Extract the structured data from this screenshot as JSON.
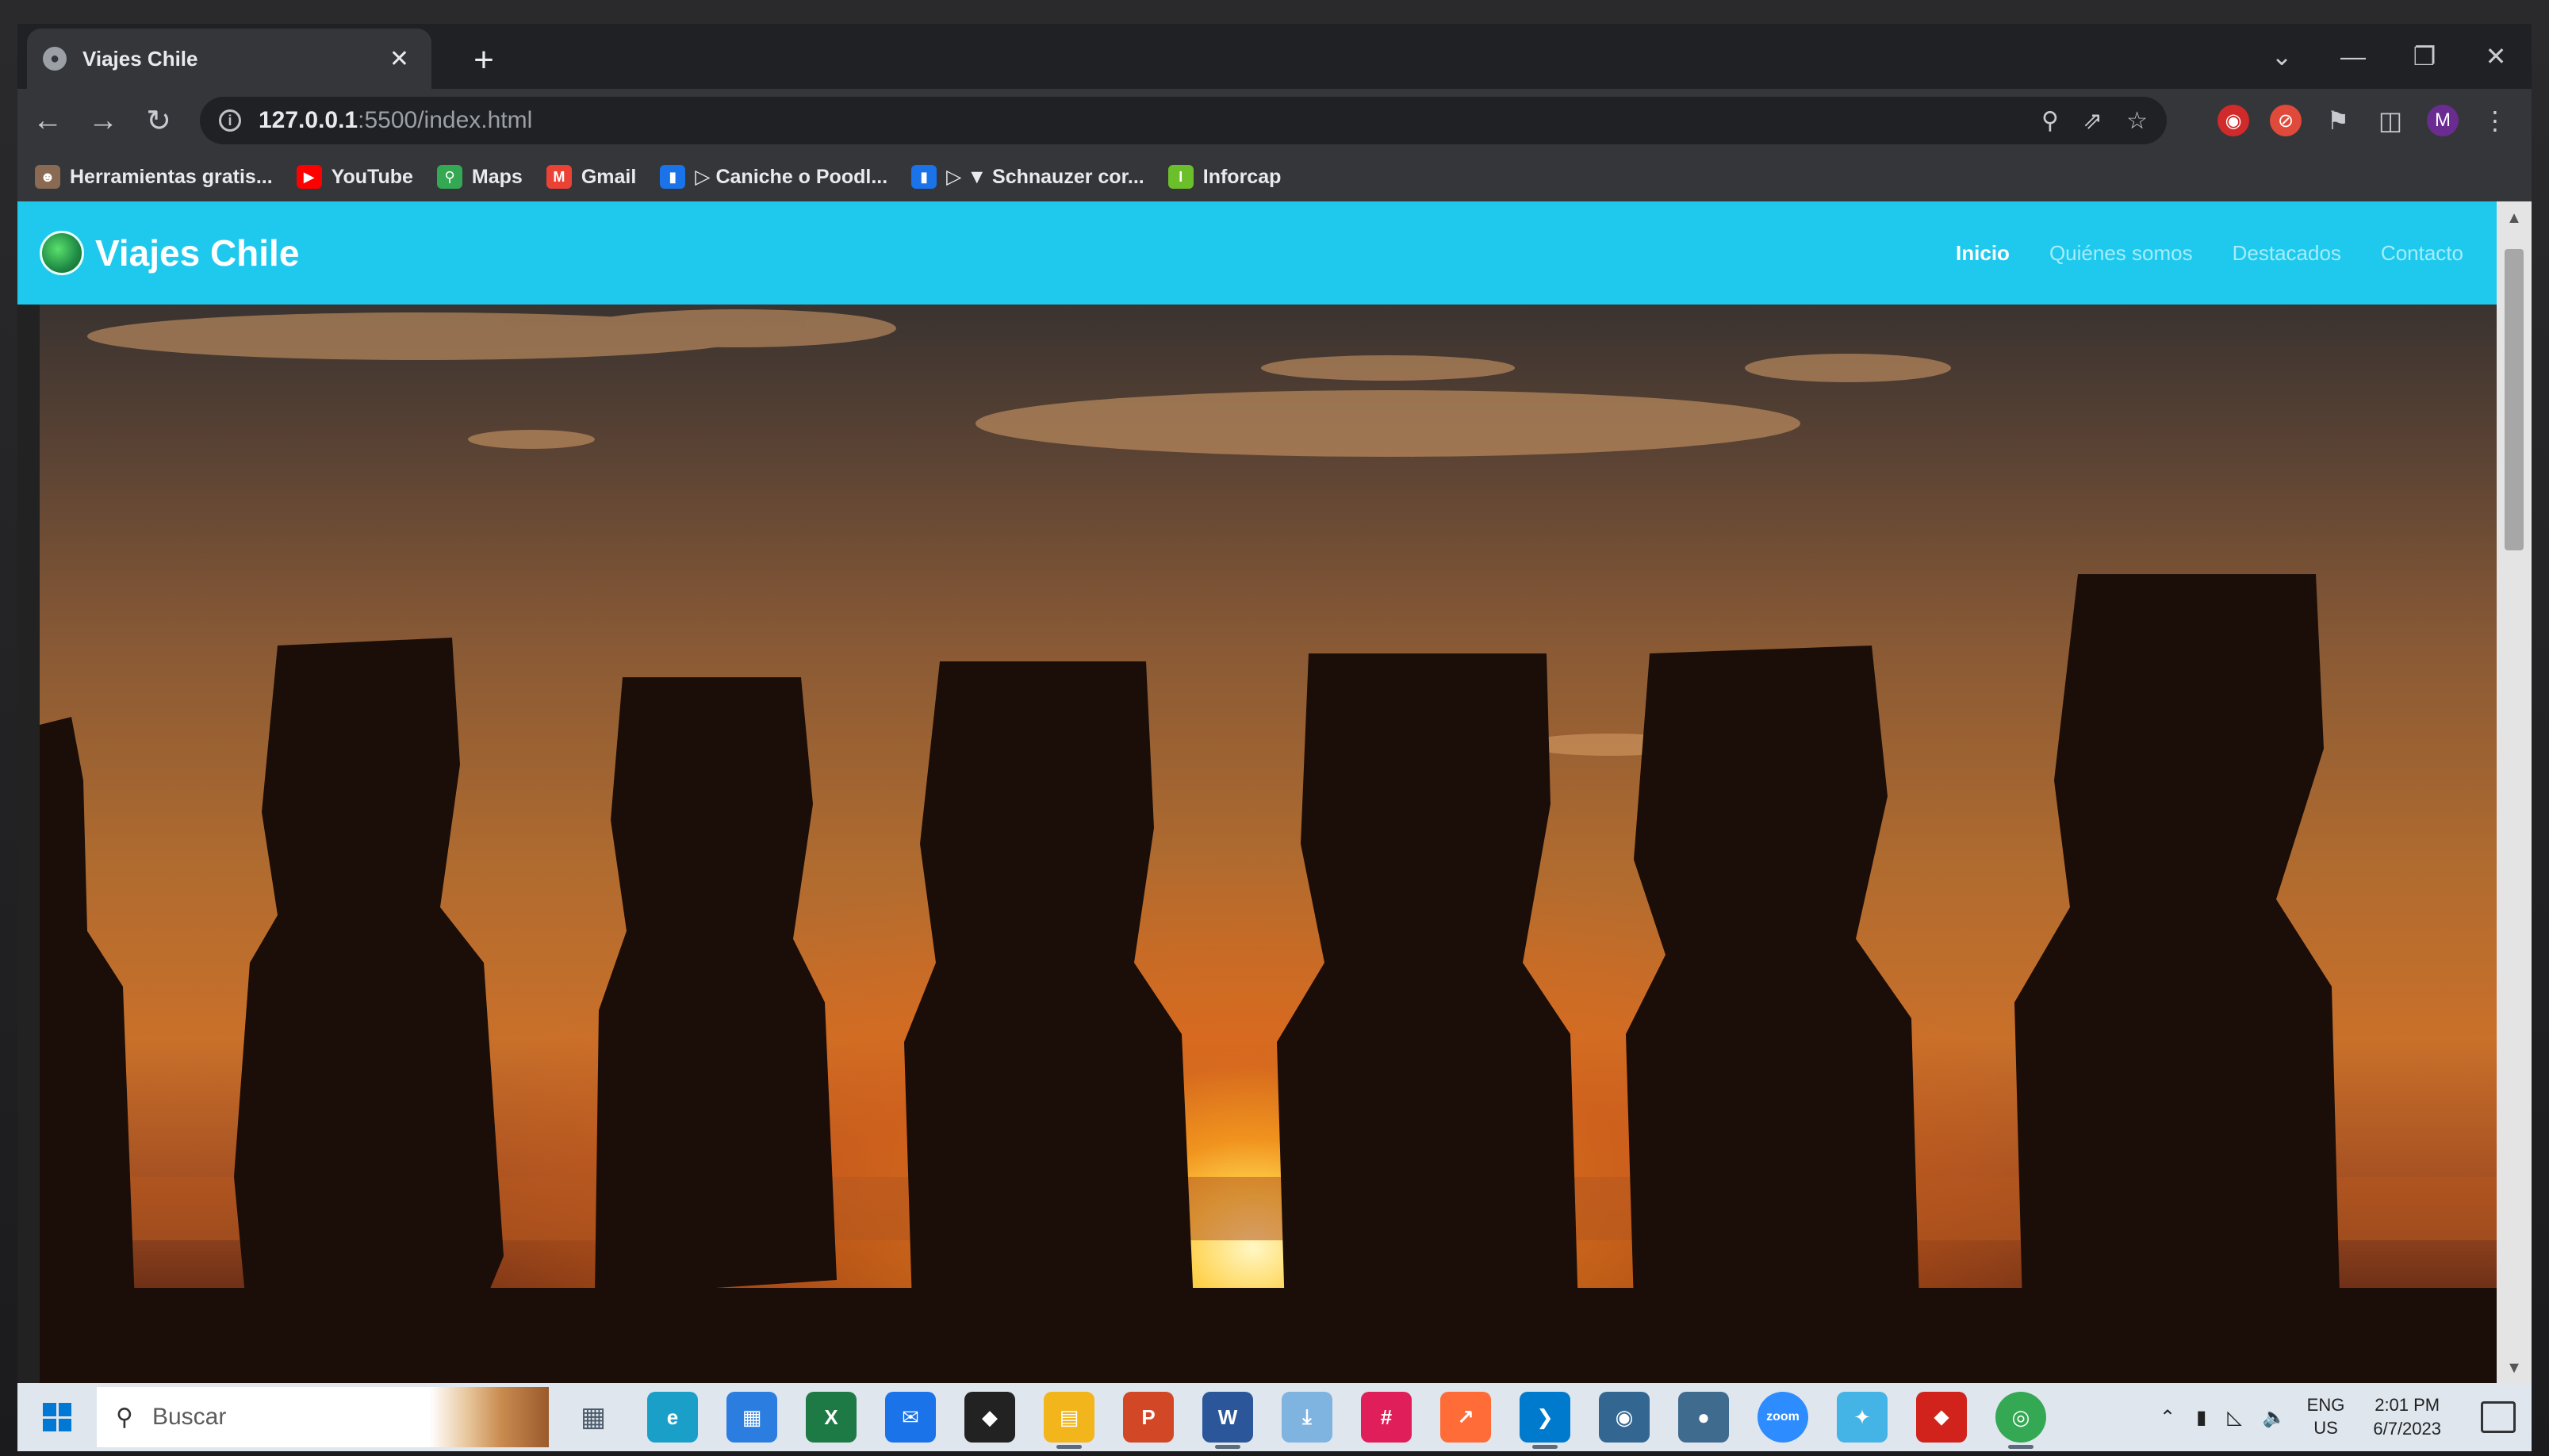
{
  "browser": {
    "tab_title": "Viajes Chile",
    "url_host": "127.0.0.1",
    "url_path": ":5500/index.html",
    "bookmarks": [
      {
        "label": "Herramientas gratis...",
        "icon": "person-icon",
        "color": "#8a6a52"
      },
      {
        "label": "YouTube",
        "icon": "youtube-icon",
        "color": "#ff0000"
      },
      {
        "label": "Maps",
        "icon": "maps-icon",
        "color": "#34a853"
      },
      {
        "label": "Gmail",
        "icon": "gmail-icon",
        "color": "#ea4335"
      },
      {
        "label": "▷ Caniche o Poodl...",
        "icon": "bookmark-doc-icon",
        "color": "#1a73e8"
      },
      {
        "label": "▷ ▼ Schnauzer cor...",
        "icon": "bookmark-doc-icon",
        "color": "#1a73e8"
      },
      {
        "label": "Inforcap",
        "icon": "inforcap-icon",
        "color": "#6bbf2a"
      }
    ],
    "profile_initial": "M"
  },
  "site": {
    "brand": "Viajes Chile",
    "nav_color": "#1fc9ee",
    "menu": [
      {
        "label": "Inicio",
        "active": true
      },
      {
        "label": "Quiénes somos",
        "active": false
      },
      {
        "label": "Destacados",
        "active": false
      },
      {
        "label": "Contacto",
        "active": false
      }
    ],
    "hero_image": "Moai statues silhouetted against sunset"
  },
  "taskbar": {
    "search_placeholder": "Buscar",
    "apps": [
      {
        "name": "task-view-icon",
        "label": "",
        "color": "#4a5a6a"
      },
      {
        "name": "edge-icon",
        "label": "e",
        "color": "#1aa0c8"
      },
      {
        "name": "store-icon",
        "label": "▦",
        "color": "#2b7de0"
      },
      {
        "name": "excel-icon",
        "label": "X",
        "color": "#1e7a45"
      },
      {
        "name": "mail-icon",
        "label": "✉",
        "color": "#1a73e8"
      },
      {
        "name": "alienware-icon",
        "label": "◆",
        "color": "#222222"
      },
      {
        "name": "file-explorer-icon",
        "label": "▤",
        "color": "#f2b51c"
      },
      {
        "name": "powerpoint-icon",
        "label": "P",
        "color": "#d24726"
      },
      {
        "name": "word-icon",
        "label": "W",
        "color": "#2b579a"
      },
      {
        "name": "downloads-icon",
        "label": "⤓",
        "color": "#7fb3e0"
      },
      {
        "name": "slack-icon",
        "label": "#",
        "color": "#e01e5a"
      },
      {
        "name": "postman-icon",
        "label": "↗",
        "color": "#ff6c37"
      },
      {
        "name": "vscode-icon",
        "label": "❯",
        "color": "#007acc"
      },
      {
        "name": "postgresql-icon",
        "label": "◉",
        "color": "#336791"
      },
      {
        "name": "pgadmin-icon",
        "label": "●",
        "color": "#3f6b8f"
      },
      {
        "name": "zoom-icon",
        "label": "zoom",
        "color": "#2d8cff"
      },
      {
        "name": "snip-icon",
        "label": "✦",
        "color": "#44b3e6"
      },
      {
        "name": "acrobat-icon",
        "label": "⬥",
        "color": "#d1231c"
      },
      {
        "name": "chrome-icon",
        "label": "◎",
        "color": "#34a853"
      }
    ],
    "lang_top": "ENG",
    "lang_bottom": "US",
    "time": "2:01 PM",
    "date": "6/7/2023"
  }
}
